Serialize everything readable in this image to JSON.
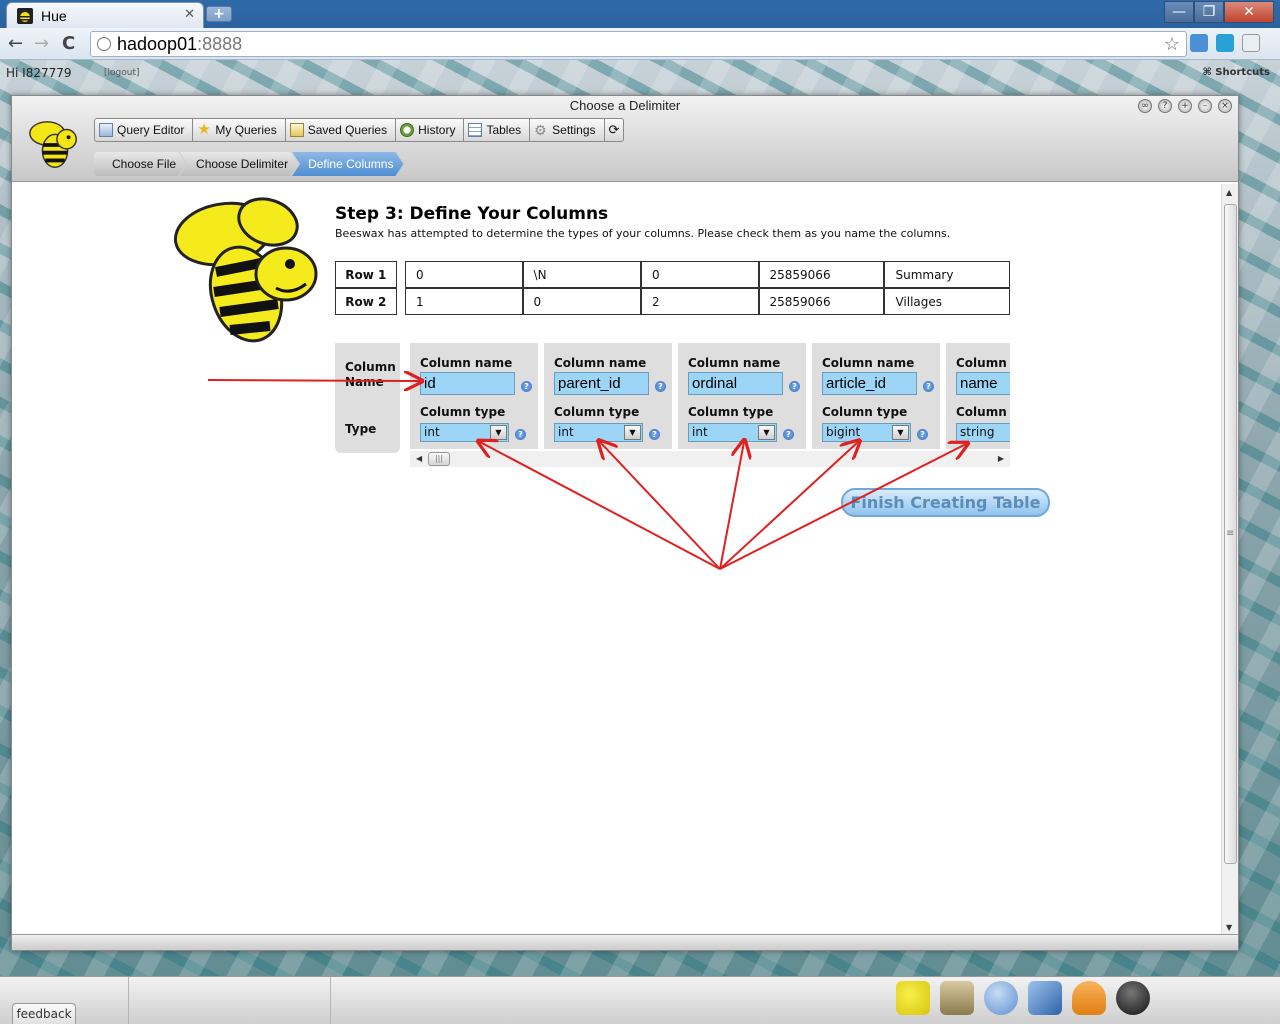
{
  "browser": {
    "tab_title": "Hue",
    "tab_close": "✕",
    "new_tab": "+",
    "url_host": "hadoop01",
    "url_port": ":8888",
    "back": "←",
    "forward": "→",
    "reload": "C",
    "window_min": "—",
    "window_max": "❐",
    "window_close": "✕"
  },
  "hue_bar": {
    "greeting": "Hi I827779",
    "logout": "[logout]",
    "shortcuts": "⌘ Shortcuts"
  },
  "app_window": {
    "title": "Choose a Delimiter",
    "nav": [
      {
        "label": "Query Editor",
        "icon": "query-editor-icon"
      },
      {
        "label": "My Queries",
        "icon": "star-icon"
      },
      {
        "label": "Saved Queries",
        "icon": "saved-queries-icon"
      },
      {
        "label": "History",
        "icon": "clock-icon"
      },
      {
        "label": "Tables",
        "icon": "tables-icon"
      },
      {
        "label": "Settings",
        "icon": "gear-icon"
      }
    ],
    "refresh": "⟳",
    "breadcrumbs": [
      "Choose File",
      "Choose Delimiter",
      "Define Columns"
    ],
    "active_crumb": "Define Columns"
  },
  "step": {
    "title": "Step 3: Define Your Columns",
    "description": "Beeswax has attempted to determine the types of your columns. Please check them as you name the columns."
  },
  "preview_rows": [
    {
      "label": "Row 1",
      "cells": [
        "0",
        "\\N",
        "0",
        "25859066",
        "Summary"
      ]
    },
    {
      "label": "Row 2",
      "cells": [
        "1",
        "0",
        "2",
        "25859066",
        "Villages"
      ]
    }
  ],
  "labels": {
    "column_name": "Column Name",
    "type": "Type"
  },
  "columns": [
    {
      "name_label": "Column name",
      "name": "id",
      "type_label": "Column type",
      "type": "int"
    },
    {
      "name_label": "Column name",
      "name": "parent_id",
      "type_label": "Column type",
      "type": "int"
    },
    {
      "name_label": "Column name",
      "name": "ordinal",
      "type_label": "Column type",
      "type": "int"
    },
    {
      "name_label": "Column name",
      "name": "article_id",
      "type_label": "Column type",
      "type": "bigint"
    },
    {
      "name_label": "Column name",
      "name": "name",
      "type_label": "Column type",
      "type": "string"
    }
  ],
  "finish_button": "Finish Creating Table",
  "taskbar": {
    "feedback": "feedback",
    "dock": [
      "beeswax-icon",
      "file-browser-icon",
      "help-icon",
      "job-designer-icon",
      "job-browser-icon",
      "user-admin-icon"
    ]
  },
  "colors": {
    "input_bg": "#9cd5f5",
    "annotation": "#e02020",
    "active_crumb": "#4f8fd2"
  }
}
